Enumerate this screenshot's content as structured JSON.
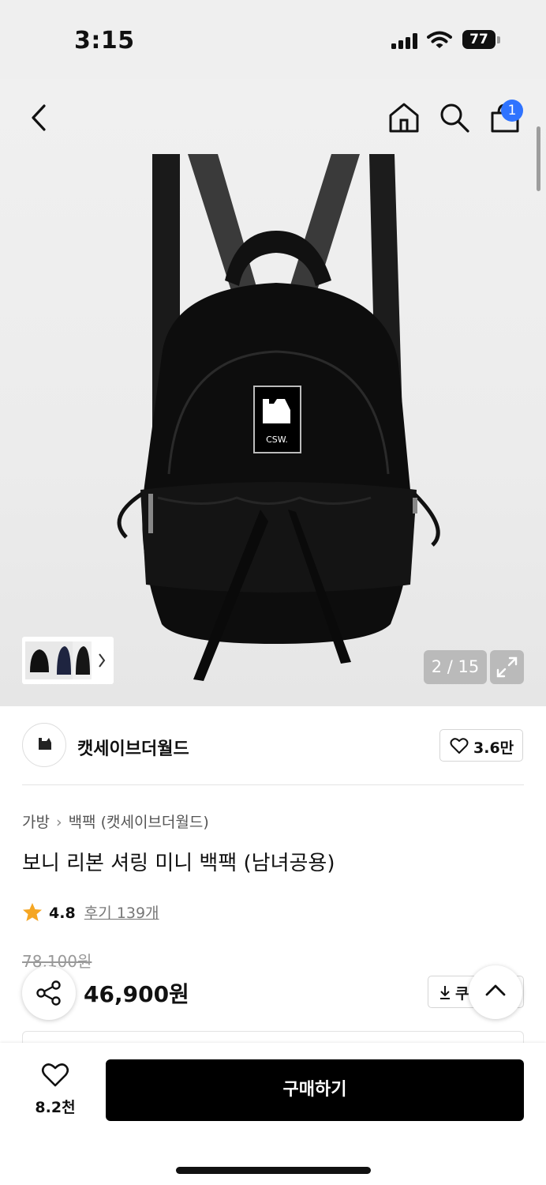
{
  "status_bar": {
    "time": "3:15",
    "battery": "77"
  },
  "header": {
    "icons": [
      "back-icon",
      "home-icon",
      "search-icon",
      "cart-icon"
    ],
    "cart_badge": "1"
  },
  "gallery": {
    "counter": "2 / 15",
    "product_logo_text": "CSW.",
    "current_index": 2,
    "total": 15
  },
  "brand": {
    "name": "캣세이브더월드",
    "like_count": "3.6만"
  },
  "product": {
    "breadcrumb": [
      "가방",
      "백팩 (캣세이브더월드)"
    ],
    "title": "보니 리본 셔링 미니 백팩 (남녀공용)",
    "rating": "4.8",
    "review_label": "후기 139개",
    "original_price": "78,100원",
    "sale_price": "46,900원",
    "coupon_label": "쿠"
  },
  "bottom_bar": {
    "wish_count": "8.2천",
    "buy_label": "구매하기"
  },
  "colors": {
    "accent_blue": "#2f73ff",
    "star": "#f5a623",
    "buy_button": "#000000"
  }
}
